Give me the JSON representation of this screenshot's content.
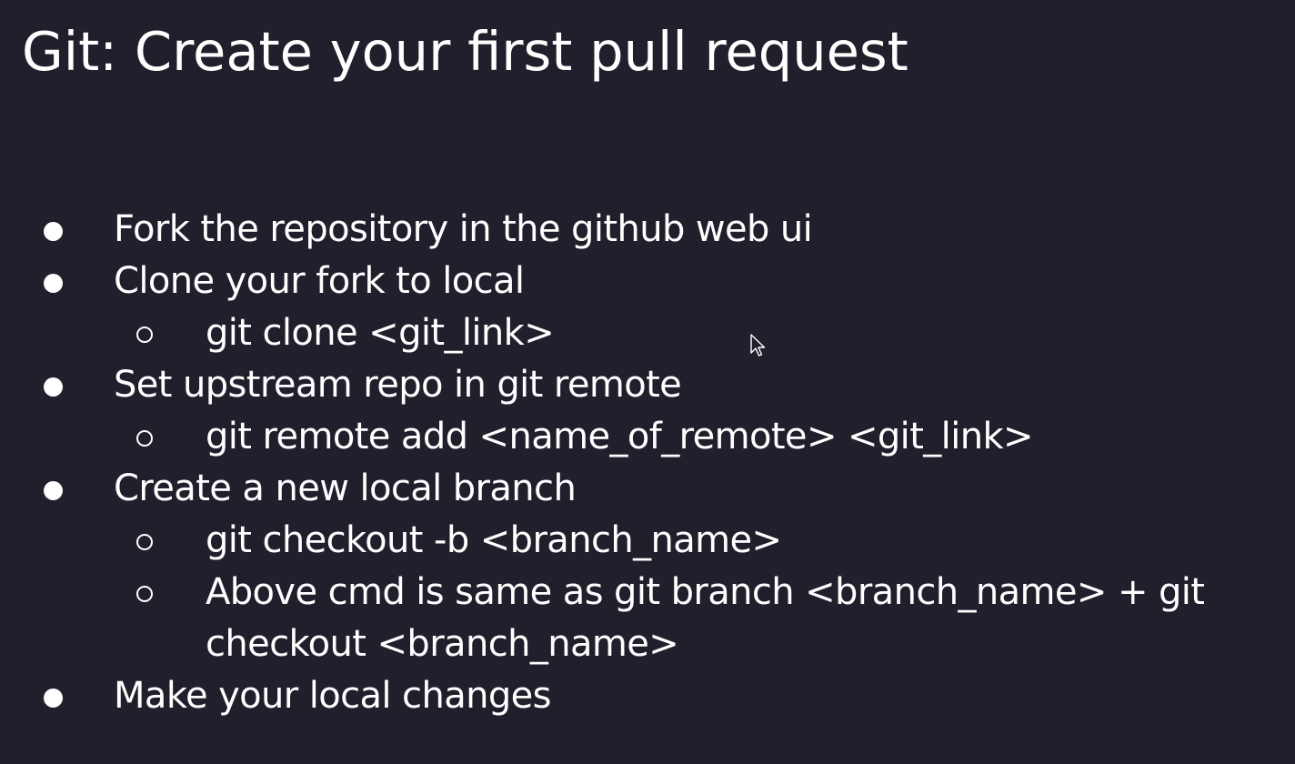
{
  "slide": {
    "title": "Git: Create your first pull request",
    "items": [
      {
        "text": "Fork the repository in the github web ui",
        "subitems": []
      },
      {
        "text": "Clone your fork to local",
        "subitems": [
          {
            "lines": [
              "git clone <git_link>"
            ]
          }
        ]
      },
      {
        "text": "Set upstream repo in git remote",
        "subitems": [
          {
            "lines": [
              "git remote add <name_of_remote> <git_link>"
            ]
          }
        ]
      },
      {
        "text": "Create a new local branch",
        "subitems": [
          {
            "lines": [
              "git checkout -b <branch_name>"
            ]
          },
          {
            "lines": [
              "Above cmd is same as git branch <branch_name> + git",
              "checkout <branch_name>"
            ]
          }
        ]
      },
      {
        "text": "Make your local changes",
        "subitems": []
      }
    ]
  },
  "colors": {
    "background": "#1f202b",
    "text": "#ffffff"
  },
  "icons": {
    "bullet": "filled-circle-bullet",
    "sub_bullet": "hollow-circle-bullet",
    "cursor": "mouse-pointer-icon"
  }
}
